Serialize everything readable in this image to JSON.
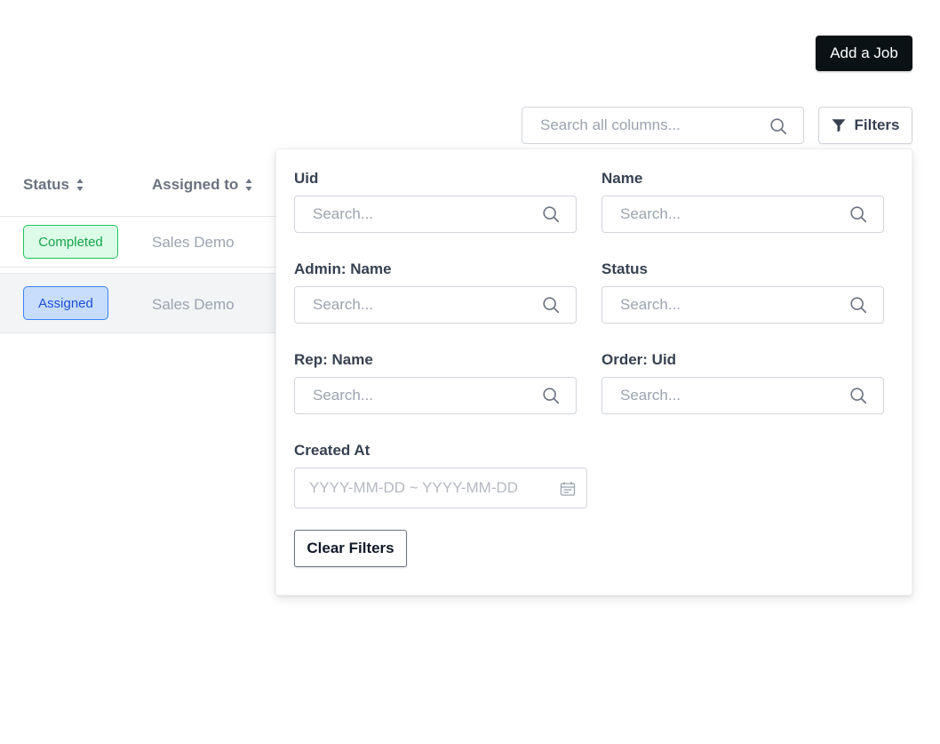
{
  "toolbar": {
    "add_job_label": "Add a Job",
    "search_placeholder": "Search all columns...",
    "filters_label": "Filters"
  },
  "table": {
    "columns": [
      "Status",
      "Assigned to"
    ],
    "rows": [
      {
        "status": "Completed",
        "assigned_to": "Sales Demo"
      },
      {
        "status": "Assigned",
        "assigned_to": "Sales Demo"
      }
    ]
  },
  "filters": {
    "fields": [
      {
        "label": "Uid",
        "placeholder": "Search..."
      },
      {
        "label": "Name",
        "placeholder": "Search..."
      },
      {
        "label": "Admin: Name",
        "placeholder": "Search..."
      },
      {
        "label": "Status",
        "placeholder": "Search..."
      },
      {
        "label": "Rep: Name",
        "placeholder": "Search..."
      },
      {
        "label": "Order: Uid",
        "placeholder": "Search..."
      }
    ],
    "created_at": {
      "label": "Created At",
      "placeholder": "YYYY-MM-DD ~ YYYY-MM-DD"
    },
    "clear_label": "Clear Filters"
  },
  "icons": {
    "search": "search-icon",
    "filter": "funnel-icon",
    "sort": "sort-icon",
    "calendar": "calendar-icon"
  },
  "colors": {
    "primary_button": "#0b1215",
    "completed_bg": "#dcfce7",
    "completed_text": "#16a34a",
    "assigned_bg": "#c7ddfb",
    "assigned_text": "#1d4ed8"
  }
}
